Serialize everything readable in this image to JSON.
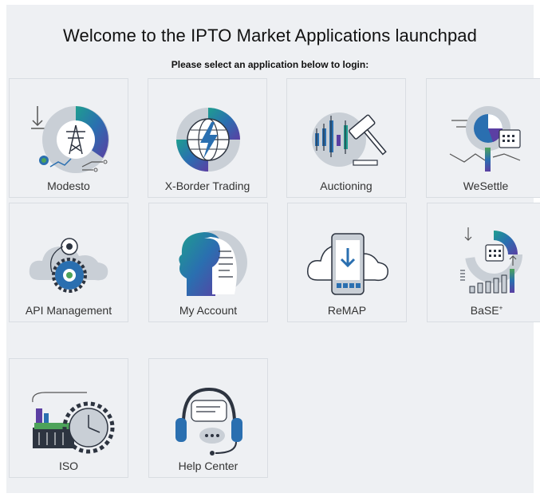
{
  "header": {
    "title": "Welcome to the IPTO Market Applications launchpad",
    "subtitle": "Please select an application below to login:"
  },
  "apps": [
    {
      "label": "Modesto",
      "icon": "transmission-tower-icon"
    },
    {
      "label": "X-Border Trading",
      "icon": "lightning-globe-icon"
    },
    {
      "label": "Auctioning",
      "icon": "gavel-chart-icon"
    },
    {
      "label": "WeSettle",
      "icon": "pie-calendar-icon"
    },
    {
      "label": "API Management",
      "icon": "cloud-gears-icon"
    },
    {
      "label": "My Account",
      "icon": "profile-head-icon"
    },
    {
      "label": "ReMAP",
      "icon": "cloud-mobile-icon"
    },
    {
      "label": "BaSE",
      "label_sup": "+",
      "icon": "balance-chart-icon"
    },
    {
      "label": "ISO",
      "icon": "factory-clock-icon"
    },
    {
      "label": "Help Center",
      "icon": "headset-chat-icon"
    }
  ],
  "colors": {
    "background": "#eef0f3",
    "accent_blue": "#2a6fb0",
    "accent_teal": "#1e9e8f",
    "accent_purple": "#5b3fa3",
    "accent_green": "#4da35a",
    "icon_grey": "#c9cfd6",
    "icon_dark": "#2d3440"
  }
}
